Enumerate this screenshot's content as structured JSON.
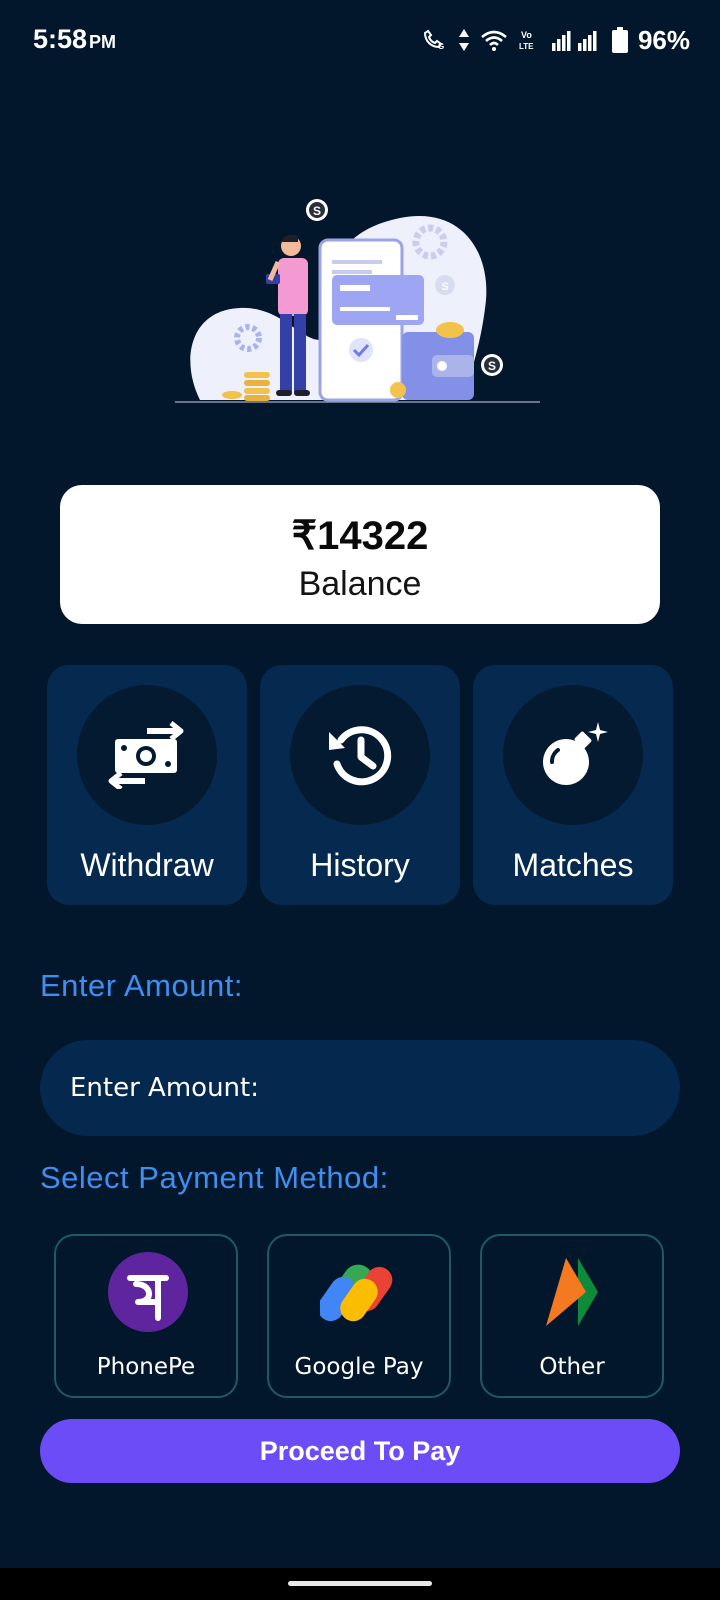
{
  "status_bar": {
    "time": "5:58",
    "ampm": "PM",
    "battery": "96%"
  },
  "wallet": {
    "balance_amount": "₹14322",
    "balance_label": "Balance"
  },
  "actions": [
    {
      "label": "Withdraw",
      "icon": "money-transfer-icon"
    },
    {
      "label": "History",
      "icon": "history-icon"
    },
    {
      "label": "Matches",
      "icon": "bomb-icon"
    }
  ],
  "amount": {
    "section_label": "Enter Amount:",
    "placeholder": "Enter Amount:",
    "value": ""
  },
  "payment": {
    "section_label": "Select Payment Method:",
    "methods": [
      {
        "label": "PhonePe",
        "icon": "phonepe-logo",
        "color": "#5f259f"
      },
      {
        "label": "Google Pay",
        "icon": "google-pay-logo"
      },
      {
        "label": "Other",
        "icon": "bhim-upi-logo"
      }
    ]
  },
  "proceed_label": "Proceed To Pay",
  "colors": {
    "background": "#02172c",
    "tile": "#06294f",
    "accent_text": "#3f8ef0",
    "button": "#6c4cf6"
  }
}
